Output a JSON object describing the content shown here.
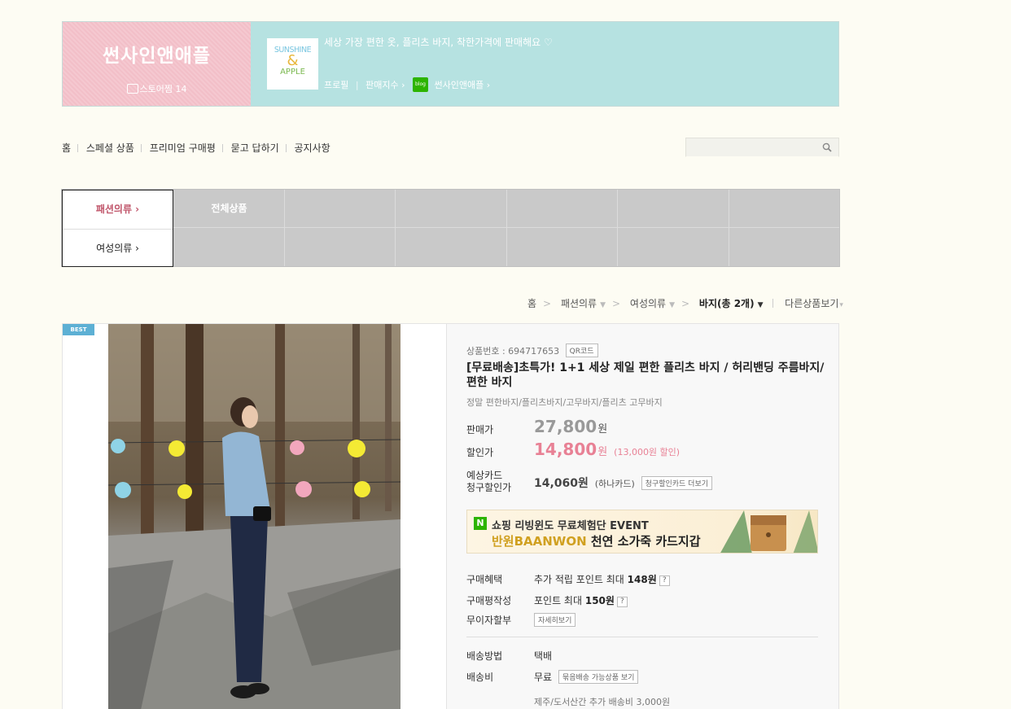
{
  "header": {
    "store_name": "썬사인앤애플",
    "zzim_label": "스토어찜 14",
    "logo": {
      "line1": "SUNSHINE",
      "line2": "&",
      "line3": "APPLE"
    },
    "description": "세상 가장 편한 옷, 플리츠 바지, 착한가격에 판매해요 ♡",
    "profile_link": "프로필",
    "sales_index": "판매지수 ›",
    "blog_icon_text": "blog",
    "blog_link": "썬사인앤애플 ›"
  },
  "nav": {
    "items": [
      "홈",
      "스페셜 상품",
      "프리미엄 구매평",
      "묻고 답하기",
      "공지사항"
    ],
    "search_placeholder": ""
  },
  "category": {
    "fashion": "패션의류 ›",
    "women": "여성의류 ›",
    "all_products": "전체상품"
  },
  "breadcrumb": {
    "home": "홈",
    "fashion": "패션의류",
    "women": "여성의류",
    "current": "바지(총 2개)",
    "other": "다른상품보기"
  },
  "product": {
    "badge": "BEST",
    "number_label": "상품번호 : 694717653",
    "qr_button": "QR코드",
    "title": "[무료배송]초특가! 1+1 세상 제일 편한 플리츠 바지 / 허리밴딩 주름바지/ 편한 바지",
    "subtitle": "정말 편한바지/플리츠바지/고무바지/플리츠 고무바지",
    "price_label": "판매가",
    "price_value": "27,800",
    "won": "원",
    "sale_label": "할인가",
    "sale_value": "14,800",
    "sale_note": "(13,000원 할인)",
    "card_label_1": "예상카드",
    "card_label_2": "청구할인가",
    "card_price": "14,060원",
    "card_name": "(하나카드)",
    "card_more_button": "청구할인카드 더보기",
    "ad_line1": "쇼핑 리빙윈도 무료체험단 EVENT",
    "ad_brand": "반원BAANWON",
    "ad_line2": " 천연 소가죽 카드지갑",
    "benefit_label": "구매혜택",
    "benefit_text": "추가 적립 포인트 최대",
    "benefit_value": "148원",
    "review_label": "구매평작성",
    "review_text": "포인트 최대",
    "review_value": "150원",
    "installment_label": "무이자할부",
    "installment_button": "자세히보기",
    "shipping_method_label": "배송방법",
    "shipping_method": "택배",
    "shipping_fee_label": "배송비",
    "shipping_fee": "무료",
    "free_ship_button": "묶음배송 가능상품 보기",
    "island_fee": "제주/도서산간 추가 배송비 3,000원"
  },
  "colors": {
    "pink_panel": "#f2bfc8",
    "mint_panel": "#b6e2e1",
    "sale_pink": "#e88195",
    "category_grey": "#c9c9c9"
  }
}
